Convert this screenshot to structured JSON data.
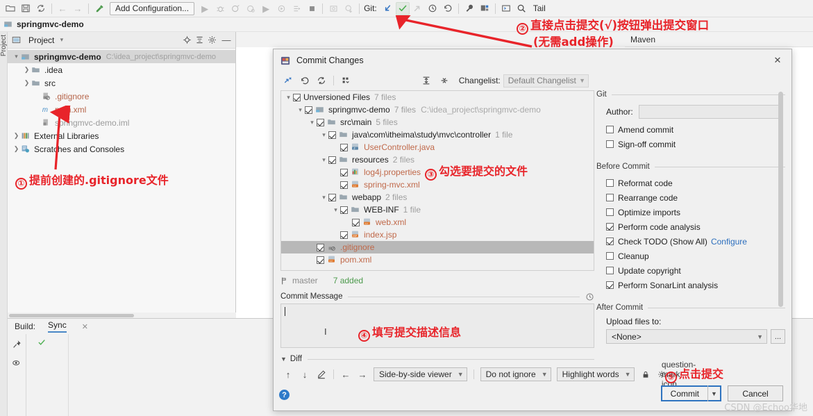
{
  "toolbar": {
    "run_config_label": "Add Configuration...",
    "git_label": "Git:",
    "tail_label": "Tail",
    "icons": [
      "open-folder-icon",
      "save-all-icon",
      "sync-icon",
      "back-arrow-icon",
      "forward-arrow-icon",
      "build-hammer-icon",
      "run-icon",
      "debug-icon",
      "run-coverage-icon",
      "profile-icon",
      "run-2-icon",
      "rerun-icon",
      "stop-icon",
      "screenshot-icon",
      "deploy-icon",
      "git-update-icon",
      "git-commit-check-icon",
      "git-push-icon",
      "git-history-icon",
      "git-rollback-icon",
      "wrench-icon",
      "structure-icon",
      "terminal-icon",
      "search-icon"
    ]
  },
  "breadcrumb": {
    "project_name": "springmvc-demo"
  },
  "left_strip": {
    "vtab_label": "Project"
  },
  "project_panel": {
    "title": "Project",
    "header_icons": [
      "locate-icon",
      "collapse-all-icon",
      "settings-gear-icon",
      "hide-icon"
    ],
    "tree": [
      {
        "label": "springmvc-demo",
        "path": "C:\\idea_project\\springmvc-demo",
        "depth": 0,
        "arrow": "expanded",
        "icon": "module-icon",
        "bold": true,
        "selected": true
      },
      {
        "label": ".idea",
        "path": "",
        "depth": 1,
        "arrow": "collapsed",
        "icon": "folder-icon",
        "bold": false,
        "selected": false
      },
      {
        "label": "src",
        "path": "",
        "depth": 1,
        "arrow": "collapsed",
        "icon": "folder-icon",
        "bold": false,
        "selected": false
      },
      {
        "label": ".gitignore",
        "path": "",
        "depth": 2,
        "arrow": "none",
        "icon": "gitignore-file-icon",
        "bold": false,
        "selected": false,
        "color": "orange"
      },
      {
        "label": "pom.xml",
        "path": "",
        "depth": 2,
        "arrow": "none",
        "icon": "maven-m-icon",
        "bold": false,
        "selected": false,
        "color": "orange"
      },
      {
        "label": "springmvc-demo.iml",
        "path": "",
        "depth": 2,
        "arrow": "none",
        "icon": "iml-file-icon",
        "bold": false,
        "selected": false,
        "color": "gray"
      },
      {
        "label": "External Libraries",
        "path": "",
        "depth": 0,
        "arrow": "collapsed",
        "icon": "libraries-icon",
        "bold": false,
        "selected": false
      },
      {
        "label": "Scratches and Consoles",
        "path": "",
        "depth": 0,
        "arrow": "collapsed",
        "icon": "scratches-icon",
        "bold": false,
        "selected": false
      }
    ]
  },
  "maven_tab": {
    "label": "Maven"
  },
  "build_panel": {
    "label": "Build:",
    "tab": "Sync",
    "side_icons": [
      "pin-icon",
      "eye-icon"
    ],
    "status_icon": "green-check-icon"
  },
  "dialog": {
    "title": "Commit Changes",
    "title_icon": "commit-dialog-icon",
    "close_icon": "close-icon",
    "toolbar_icons": [
      "show-diff-icon",
      "revert-icon",
      "refresh-icon",
      "group-by-icon"
    ],
    "view_icons": [
      "expand-all-icon",
      "collapse-all-icon"
    ],
    "changelist_label": "Changelist:",
    "changelist_value": "Default Changelist",
    "file_tree": [
      {
        "label": "Unversioned Files",
        "count": "7 files",
        "path": "",
        "depth": 0,
        "arrow": "expanded",
        "icon": "none",
        "checked": true,
        "selected": false,
        "color": ""
      },
      {
        "label": "springmvc-demo",
        "count": "7 files",
        "path": "C:\\idea_project\\springmvc-demo",
        "depth": 1,
        "arrow": "expanded",
        "icon": "module-icon",
        "checked": true,
        "selected": false,
        "color": ""
      },
      {
        "label": "src\\main",
        "count": "5 files",
        "path": "",
        "depth": 2,
        "arrow": "expanded",
        "icon": "folder-icon",
        "checked": true,
        "selected": false,
        "color": ""
      },
      {
        "label": "java\\com\\itheima\\study\\mvc\\controller",
        "count": "1 file",
        "path": "",
        "depth": 3,
        "arrow": "expanded",
        "icon": "folder-icon",
        "checked": true,
        "selected": false,
        "color": ""
      },
      {
        "label": "UserController.java",
        "count": "",
        "path": "",
        "depth": 4,
        "arrow": "none",
        "icon": "java-file-icon",
        "checked": true,
        "selected": false,
        "color": "orange"
      },
      {
        "label": "resources",
        "count": "2 files",
        "path": "",
        "depth": 3,
        "arrow": "expanded",
        "icon": "folder-icon",
        "checked": true,
        "selected": false,
        "color": ""
      },
      {
        "label": "log4j.properties",
        "count": "",
        "path": "",
        "depth": 4,
        "arrow": "none",
        "icon": "properties-file-icon",
        "checked": true,
        "selected": false,
        "color": "orange"
      },
      {
        "label": "spring-mvc.xml",
        "count": "",
        "path": "",
        "depth": 4,
        "arrow": "none",
        "icon": "xml-file-icon",
        "checked": true,
        "selected": false,
        "color": "orange"
      },
      {
        "label": "webapp",
        "count": "2 files",
        "path": "",
        "depth": 3,
        "arrow": "expanded",
        "icon": "folder-icon",
        "checked": true,
        "selected": false,
        "color": ""
      },
      {
        "label": "WEB-INF",
        "count": "1 file",
        "path": "",
        "depth": 4,
        "arrow": "expanded",
        "icon": "folder-icon",
        "checked": true,
        "selected": false,
        "color": ""
      },
      {
        "label": "web.xml",
        "count": "",
        "path": "",
        "depth": 5,
        "arrow": "none",
        "icon": "xml-file-icon",
        "checked": true,
        "selected": false,
        "color": "orange"
      },
      {
        "label": "index.jsp",
        "count": "",
        "path": "",
        "depth": 4,
        "arrow": "none",
        "icon": "jsp-file-icon",
        "checked": true,
        "selected": false,
        "color": "orange"
      },
      {
        "label": ".gitignore",
        "count": "",
        "path": "",
        "depth": 2,
        "arrow": "none",
        "icon": "gitignore-file-icon",
        "checked": true,
        "selected": true,
        "color": "orange"
      },
      {
        "label": "pom.xml",
        "count": "",
        "path": "",
        "depth": 2,
        "arrow": "none",
        "icon": "xml-file-icon",
        "checked": true,
        "selected": false,
        "color": "orange"
      }
    ],
    "branch_icon": "branch-icon",
    "branch_name": "master",
    "added_status": "7 added",
    "commit_message_label": "Commit Message",
    "commit_message_value": "",
    "commit_message_history_icon": "history-clock-icon",
    "diff_label": "Diff",
    "diff_toolbar": {
      "icons": [
        "prev-diff-icon",
        "next-diff-icon",
        "edit-icon",
        "apply-left-icon",
        "apply-right-icon"
      ],
      "viewer_mode": "Side-by-side viewer",
      "ignore_mode": "Do not ignore",
      "highlight_mode": "Highlight words",
      "lock_icon": "lock-icon",
      "settings_icon": "settings-gear-icon",
      "help_icon": "question-mark-icon"
    },
    "help_button": "?",
    "commit_button": "Commit",
    "cancel_button": "Cancel",
    "options": {
      "git_group": "Git",
      "author_label": "Author:",
      "author_value": "",
      "amend_commit": {
        "label": "Amend commit",
        "checked": false
      },
      "signoff_commit": {
        "label": "Sign-off commit",
        "checked": false
      },
      "before_commit_group": "Before Commit",
      "before_items": [
        {
          "label": "Reformat code",
          "checked": false,
          "link": ""
        },
        {
          "label": "Rearrange code",
          "checked": false,
          "link": ""
        },
        {
          "label": "Optimize imports",
          "checked": false,
          "link": ""
        },
        {
          "label": "Perform code analysis",
          "checked": true,
          "link": ""
        },
        {
          "label": "Check TODO (Show All)",
          "checked": true,
          "link": "Configure"
        },
        {
          "label": "Cleanup",
          "checked": false,
          "link": ""
        },
        {
          "label": "Update copyright",
          "checked": false,
          "link": ""
        },
        {
          "label": "Perform SonarLint analysis",
          "checked": true,
          "link": ""
        }
      ],
      "after_commit_group": "After Commit",
      "upload_label": "Upload files to:",
      "upload_value": "<None>",
      "dots_button": "..."
    }
  },
  "annotations": [
    {
      "id": "anno-1",
      "num": "①",
      "text": "提前创建的.gitignore文件"
    },
    {
      "id": "anno-2",
      "num": "②",
      "line1": "直接点击提交(√)按钮弹出提交窗口",
      "line2": "(无需add操作)"
    },
    {
      "id": "anno-3",
      "num": "③",
      "text": "勾选要提交的文件"
    },
    {
      "id": "anno-4",
      "num": "④",
      "text": "填写提交描述信息"
    },
    {
      "id": "anno-5",
      "num": "⑤",
      "text": "点击提交"
    }
  ],
  "watermark": "CSDN @Echoo华地",
  "colors": {
    "accent_red": "#e8242a",
    "link_blue": "#2d6fbd",
    "primary_border": "#2f74c0",
    "added_green": "#4c9a4c",
    "file_orange": "#c0694a"
  }
}
